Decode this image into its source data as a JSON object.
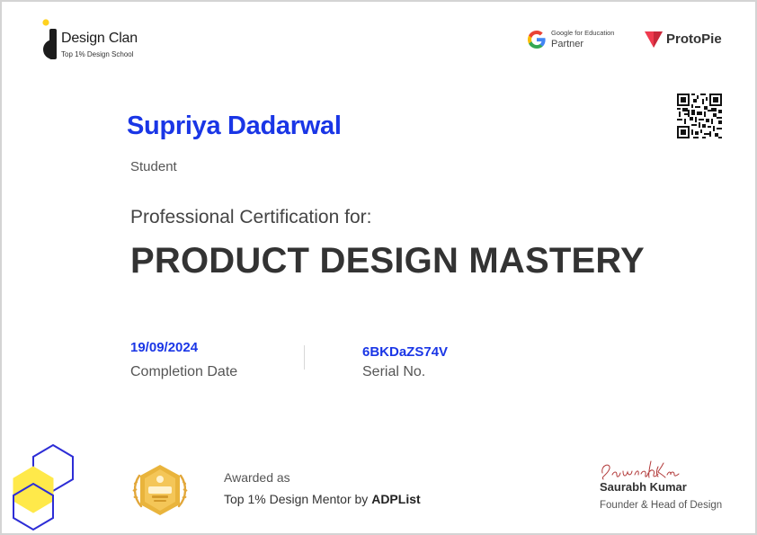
{
  "brand": {
    "name": "Design Clan",
    "tagline": "Top 1% Design School",
    "logo_icon": "design-clan-logo-icon"
  },
  "partners": {
    "google": {
      "small": "Google for Education",
      "big": "Partner",
      "icon": "google-g-icon"
    },
    "protopie": {
      "name": "ProtoPie",
      "icon": "protopie-icon"
    }
  },
  "qr_icon": "qr-code-icon",
  "recipient": {
    "name": "Supriya Dadarwal",
    "role": "Student"
  },
  "certification": {
    "prefix": "Professional Certification for:",
    "course": "PRODUCT DESIGN MASTERY"
  },
  "completion": {
    "date": "19/09/2024",
    "date_label": "Completion Date",
    "serial": "6BKDaZS74V",
    "serial_label": "Serial No."
  },
  "award": {
    "line1": "Awarded as",
    "line2": "Top 1% Design Mentor by ",
    "line2_bold": "ADPList",
    "badge_icon": "adplist-mentor-badge-icon"
  },
  "signatory": {
    "signature": "Saurabh Kumar",
    "name": "Saurabh Kumar",
    "title": "Founder & Head of Design"
  },
  "colors": {
    "accent_blue": "#1a36e6",
    "hex_blue": "#2d2dd6",
    "hex_yellow": "#ffe94a",
    "badge_gold": "#e9b43c",
    "protopie_red": "#ef3b4f"
  }
}
